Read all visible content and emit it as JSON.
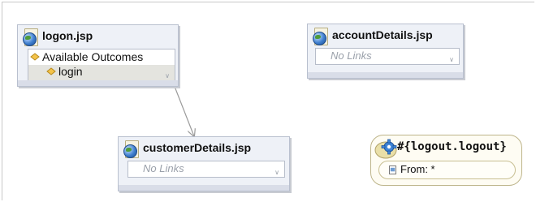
{
  "nodes": {
    "logon": {
      "title": "logon.jsp",
      "outcomes_header": "Available Outcomes",
      "outcome": "login"
    },
    "accountDetails": {
      "title": "accountDetails.jsp",
      "links": "No Links"
    },
    "customerDetails": {
      "title": "customerDetails.jsp",
      "links": "No Links"
    },
    "logout": {
      "title": "#{logout.logout}",
      "from": "From: *"
    }
  }
}
